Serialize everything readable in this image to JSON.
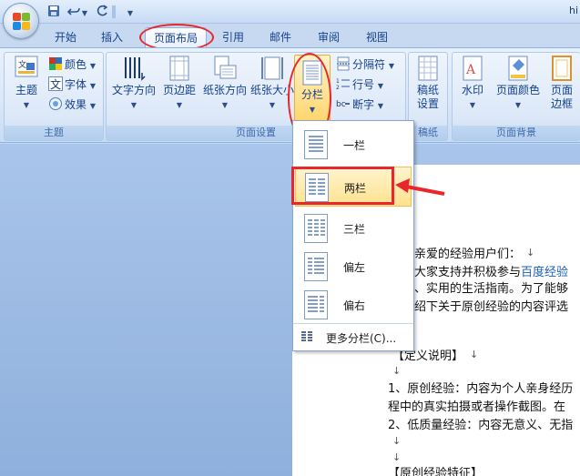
{
  "qa_toolbar": {
    "save_icon": "save-icon",
    "undo_icon": "undo-icon",
    "redo_icon": "redo-icon"
  },
  "title_text": "hi",
  "tabs": [
    "开始",
    "插入",
    "页面布局",
    "引用",
    "邮件",
    "审阅",
    "视图"
  ],
  "active_tab": "页面布局",
  "groups": {
    "theme": {
      "label": "主题",
      "theme_btn": "主题",
      "colors": "颜色",
      "fonts": "字体",
      "effects": "效果"
    },
    "page_setup": {
      "label": "页面设置",
      "text_direction": "文字方向",
      "margins": "页边距",
      "orientation": "纸张方向",
      "size": "纸张大小",
      "columns": "分栏",
      "breaks": "分隔符",
      "line_numbers": "行号",
      "hyphenation": "断字"
    },
    "draft": {
      "label": "稿纸",
      "btn": "稿纸\n设置"
    },
    "page_background": {
      "label": "页面背景",
      "watermark": "水印",
      "page_color": "页面颜色",
      "page_border_line1": "页面",
      "page_border_line2": "边框"
    }
  },
  "columns_dropdown": {
    "items": [
      "一栏",
      "两栏",
      "三栏",
      "偏左",
      "偏右"
    ],
    "highlighted": "两栏",
    "more": "更多分栏(C)..."
  },
  "document": {
    "lines": [
      "亲爱的经验用户们：",
      "大家支持并积极参与",
      "百度经验",
      "、实用的生活指南。为了能够",
      "绍下关于原创经验的内容评选",
      "【定义说明】",
      "1、原创经验：内容为个人亲身经历",
      "程中的真实拍摄或者操作截图。在",
      "2、低质量经验：内容无意义、无指",
      "【原创经验特征】"
    ]
  },
  "colors": {
    "accent_red": "#e8262c",
    "ribbon_text": "#15428b"
  }
}
